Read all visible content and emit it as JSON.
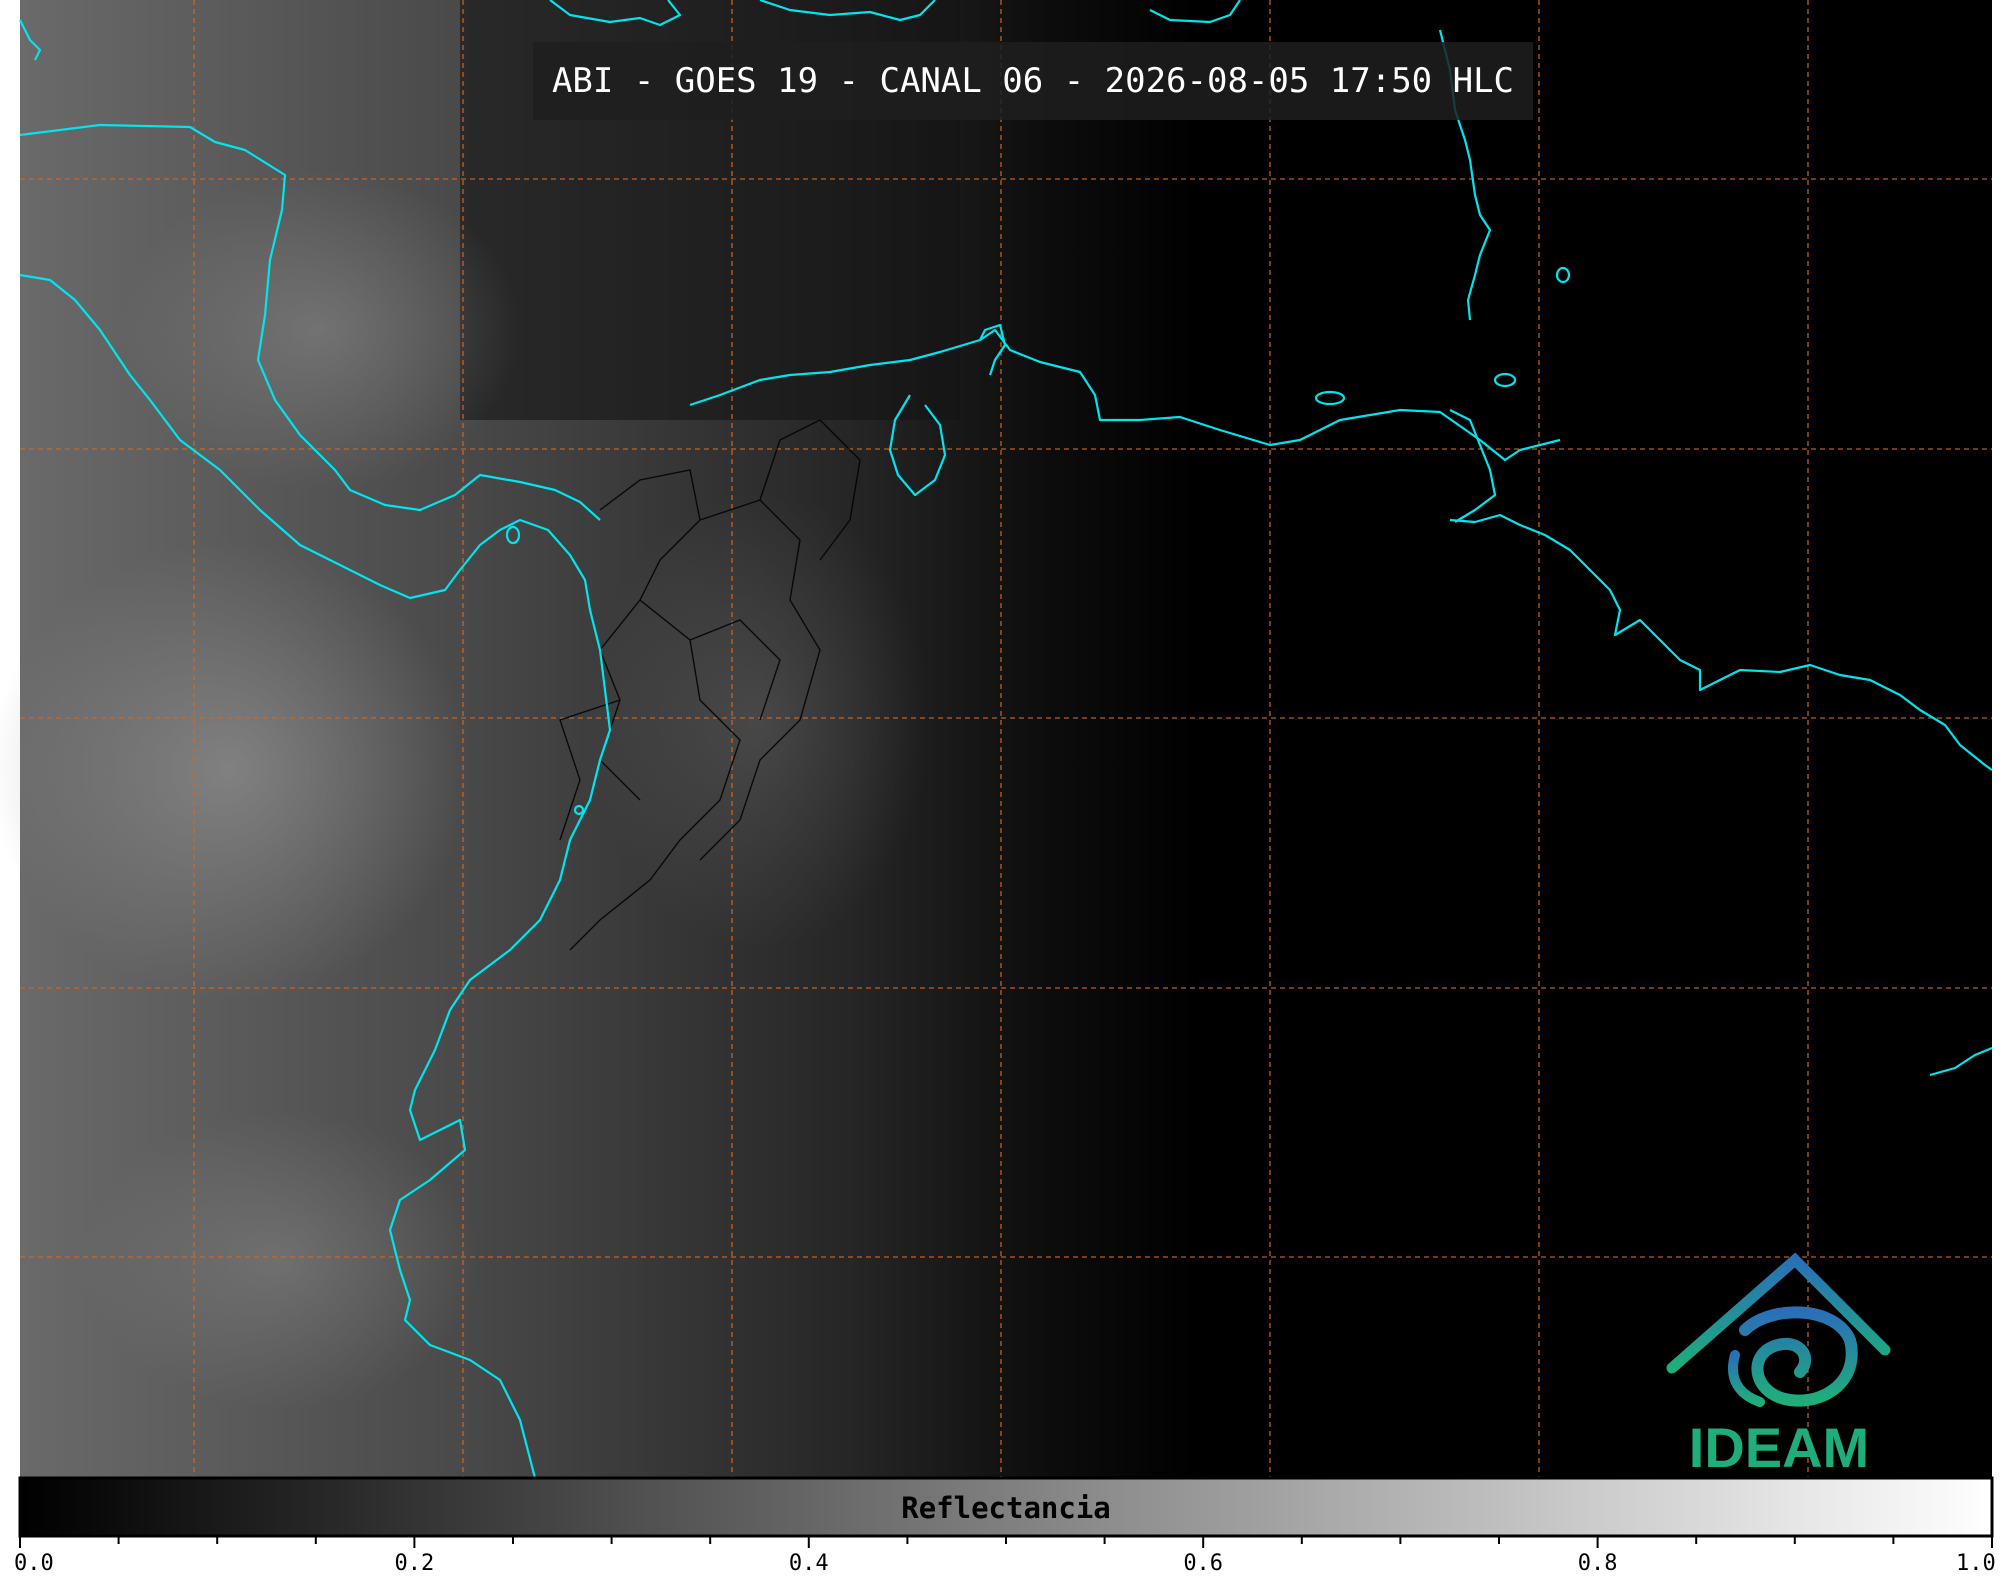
{
  "map": {
    "title": "ABI - GOES 19 - CANAL 06 - 2026-08-05 17:50 HLC",
    "colors": {
      "coastline": "#00e5ee",
      "borders": "#000000",
      "grid": "#d2691e",
      "background": "#000000"
    }
  },
  "colorbar": {
    "label": "Reflectancia",
    "range": [
      0.0,
      1.0
    ],
    "colormap": "grayscale-black-to-white",
    "tick_labels": [
      "0.0",
      "0.2",
      "0.4",
      "0.6",
      "0.8",
      "1.0"
    ]
  },
  "logo": {
    "text": "IDEAM",
    "icon": "ideam-spiral-mountain-logo",
    "colors": {
      "top": "#2a6fb8",
      "bottom": "#1fae7a"
    }
  }
}
